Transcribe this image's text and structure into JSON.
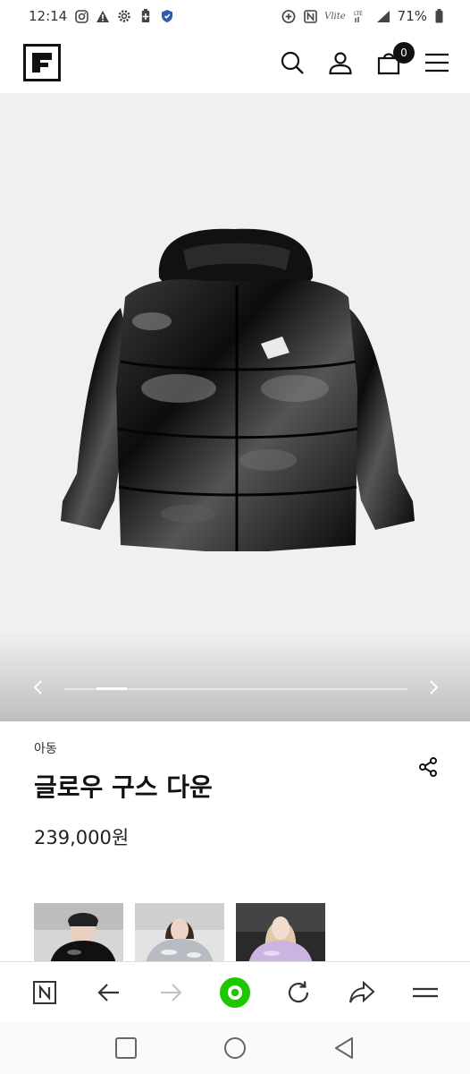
{
  "status_bar": {
    "time": "12:14",
    "carrier_label": "Vlite",
    "battery": "71%",
    "left_icons": [
      "instagram-icon",
      "warning-icon",
      "settings-icon",
      "battery-saver-icon",
      "shield-icon"
    ],
    "right_icons": [
      "data-saver-icon",
      "nfc-icon",
      "volte-icon",
      "signal-icon",
      "battery-icon"
    ]
  },
  "header": {
    "logo": "fila-logo",
    "icons": [
      "search-icon",
      "account-icon",
      "cart-icon",
      "menu-icon"
    ],
    "cart_count": "0"
  },
  "product": {
    "category": "아동",
    "title": "글로우 구스 다운",
    "price": "239,000원",
    "carousel": {
      "active_index": 1,
      "total_slides": 10
    }
  },
  "thumbnails": [
    {
      "name": "thumbnail-black-jacket"
    },
    {
      "name": "thumbnail-silver-jacket"
    },
    {
      "name": "thumbnail-lilac-jacket"
    }
  ],
  "browser_bar": {
    "icons": [
      "naver-icon",
      "back-arrow-icon",
      "forward-arrow-icon",
      "home-green-icon",
      "reload-icon",
      "share-icon",
      "menu-icon"
    ]
  },
  "colors": {
    "accent_green": "#1ec800",
    "hero_bg": "#f0f0f0",
    "text_primary": "#111111"
  }
}
